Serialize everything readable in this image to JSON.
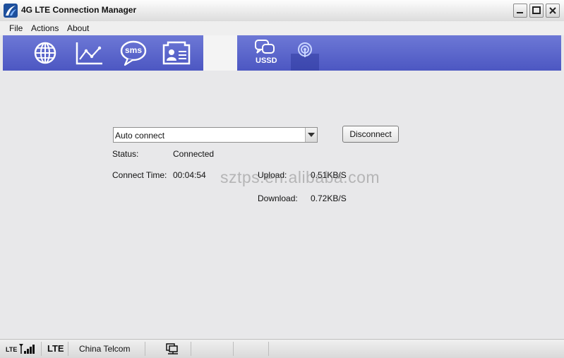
{
  "window": {
    "title": "4G LTE Connection Manager"
  },
  "menu": {
    "items": [
      "File",
      "Actions",
      "About"
    ]
  },
  "toolbar": {
    "sms_label": "sms",
    "ussd_label": "USSD"
  },
  "connection": {
    "profile_value": "Auto connect",
    "disconnect_label": "Disconnect",
    "status_label": "Status:",
    "status_value": "Connected",
    "connect_time_label": "Connect Time:",
    "connect_time_value": "00:04:54",
    "upload_label": "Upload:",
    "upload_value": "0.51KB/S",
    "download_label": "Download:",
    "download_value": "0.72KB/S"
  },
  "watermark": "sztps.en.alibaba.com",
  "statusbar": {
    "signal_network": "LTE",
    "network_type": "LTE",
    "carrier": "China Telcom"
  }
}
